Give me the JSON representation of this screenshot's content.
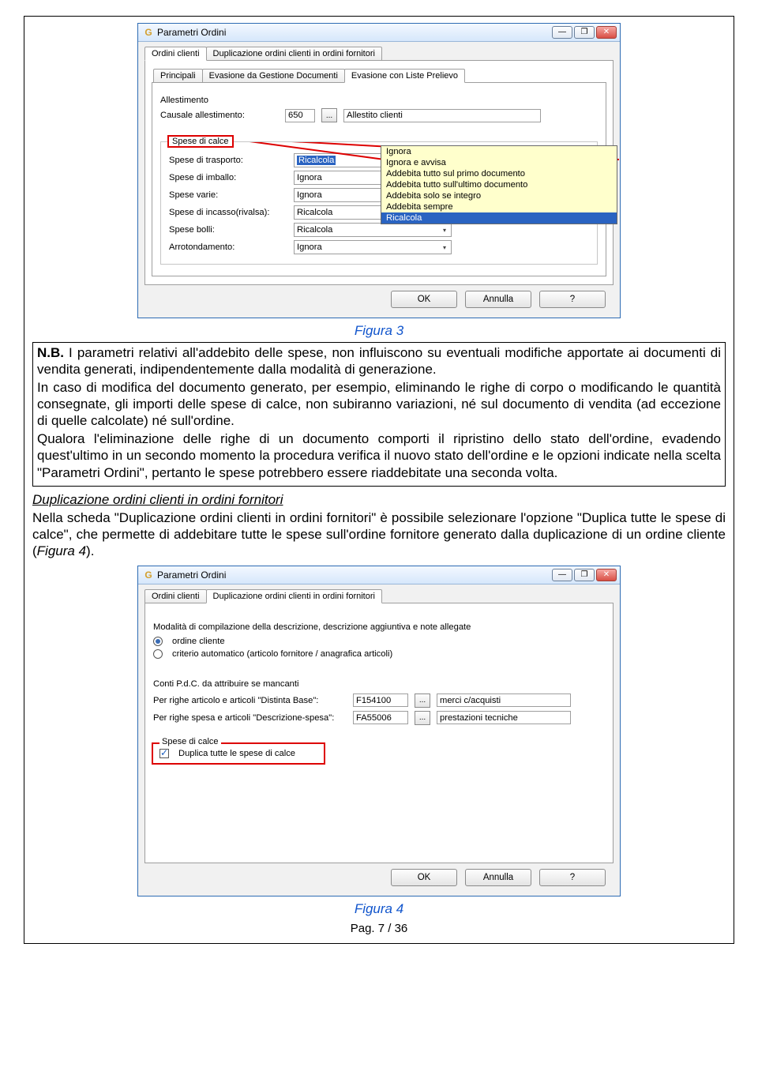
{
  "dialog1": {
    "app_icon": "G",
    "title": "Parametri Ordini",
    "win_controls": {
      "min": "—",
      "max": "❐",
      "close": "✕"
    },
    "tabs": [
      "Ordini clienti",
      "Duplicazione ordini clienti in ordini fornitori"
    ],
    "active_tab": 0,
    "subtabs": [
      "Principali",
      "Evasione da Gestione Documenti",
      "Evasione con Liste Prelievo"
    ],
    "active_subtab": 2,
    "allestimento": {
      "group_label": "Allestimento",
      "causale_label": "Causale allestimento:",
      "causale_code": "650",
      "ellipsis": "...",
      "causale_desc": "Allestito clienti"
    },
    "spese_group_label": "Spese di calce",
    "rows": [
      {
        "label": "Spese di trasporto:",
        "value": "Ricalcola",
        "hilite": true
      },
      {
        "label": "Spese di imballo:",
        "value": "Ignora"
      },
      {
        "label": "Spese varie:",
        "value": "Ignora"
      },
      {
        "label": "Spese di incasso(rivalsa):",
        "value": "Ricalcola"
      },
      {
        "label": "Spese bolli:",
        "value": "Ricalcola"
      },
      {
        "label": "Arrotondamento:",
        "value": "Ignora"
      }
    ],
    "popup_options": [
      "Ignora",
      "Ignora e avvisa",
      "Addebita tutto sul primo documento",
      "Addebita tutto sull'ultimo documento",
      "Addebita solo se integro",
      "Addebita sempre",
      "Ricalcola"
    ],
    "popup_selected": 6,
    "buttons": {
      "ok": "OK",
      "cancel": "Annulla",
      "help": "?"
    }
  },
  "fig3_caption": "Figura 3",
  "note": {
    "lead": "N.B.",
    "p1": " I parametri relativi all'addebito delle spese, non influiscono su eventuali modifiche apportate ai documenti di vendita generati, indipendentemente dalla modalità di generazione.",
    "p2": "In caso di modifica del documento generato, per esempio, eliminando le righe di corpo o modificando le quantità consegnate, gli importi delle spese di calce, non subiranno variazioni, né sul documento di vendita (ad eccezione di quelle calcolate) né sull'ordine.",
    "p3": "Qualora l'eliminazione delle righe di un documento comporti il ripristino dello stato dell'ordine, evadendo quest'ultimo in un secondo momento la procedura verifica il nuovo stato dell'ordine e le opzioni indicate nella scelta \"Parametri Ordini\", pertanto le spese potrebbero essere riaddebitate una seconda volta."
  },
  "section": {
    "heading": "Duplicazione ordini clienti in ordini fornitori",
    "p1a": "Nella scheda \"Duplicazione ordini clienti in ordini fornitori\" è possibile selezionare l'opzione \"Duplica tutte le spese di calce\", che permette di addebitare tutte le spese sull'ordine fornitore generato dalla duplicazione di un ordine cliente (",
    "fig_ref": "Figura 4",
    "p1b": ")."
  },
  "dialog2": {
    "app_icon": "G",
    "title": "Parametri Ordini",
    "win_controls": {
      "min": "—",
      "max": "❐",
      "close": "✕"
    },
    "tabs": [
      "Ordini clienti",
      "Duplicazione ordini clienti in ordini fornitori"
    ],
    "active_tab": 1,
    "group1_label": "Modalità di compilazione della descrizione, descrizione aggiuntiva e note allegate",
    "radio1": "ordine cliente",
    "radio2": "criterio automatico (articolo fornitore / anagrafica articoli)",
    "group2_label": "Conti P.d.C. da attribuire se mancanti",
    "row_articolo": {
      "label": "Per righe articolo e articoli \"Distinta Base\":",
      "code": "F154100",
      "ellipsis": "...",
      "desc": "merci c/acquisti"
    },
    "row_spesa": {
      "label": "Per righe spesa e articoli \"Descrizione-spesa\":",
      "code": "FA55006",
      "ellipsis": "...",
      "desc": "prestazioni tecniche"
    },
    "calce_label": "Spese di calce",
    "chk_label": "Duplica tutte le spese di calce",
    "buttons": {
      "ok": "OK",
      "cancel": "Annulla",
      "help": "?"
    }
  },
  "fig4_caption": "Figura 4",
  "pager": "Pag. 7 / 36"
}
